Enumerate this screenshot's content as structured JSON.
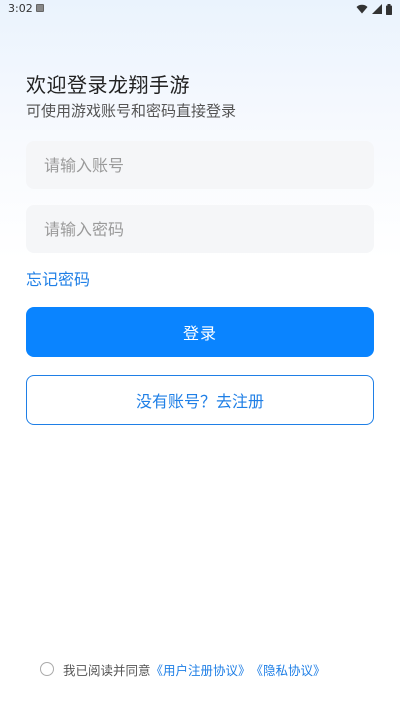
{
  "status_bar": {
    "time": "3:02",
    "notification_icon": "notification-a-icon",
    "icons": [
      "wifi-icon",
      "signal-icon",
      "battery-icon"
    ]
  },
  "header": {
    "title": "欢迎登录龙翔手游",
    "subtitle": "可使用游戏账号和密码直接登录"
  },
  "form": {
    "account_placeholder": "请输入账号",
    "account_value": "",
    "password_placeholder": "请输入密码",
    "password_value": "",
    "forgot_password": "忘记密码",
    "login_button": "登录",
    "register_button": "没有账号？去注册"
  },
  "agreement": {
    "checked": false,
    "text": "我已阅读并同意",
    "user_agreement": "《用户注册协议》",
    "privacy_agreement": "《隐私协议》"
  },
  "colors": {
    "primary": "#0a84ff",
    "link": "#1f7fe6",
    "input_bg": "#f5f6f8"
  }
}
